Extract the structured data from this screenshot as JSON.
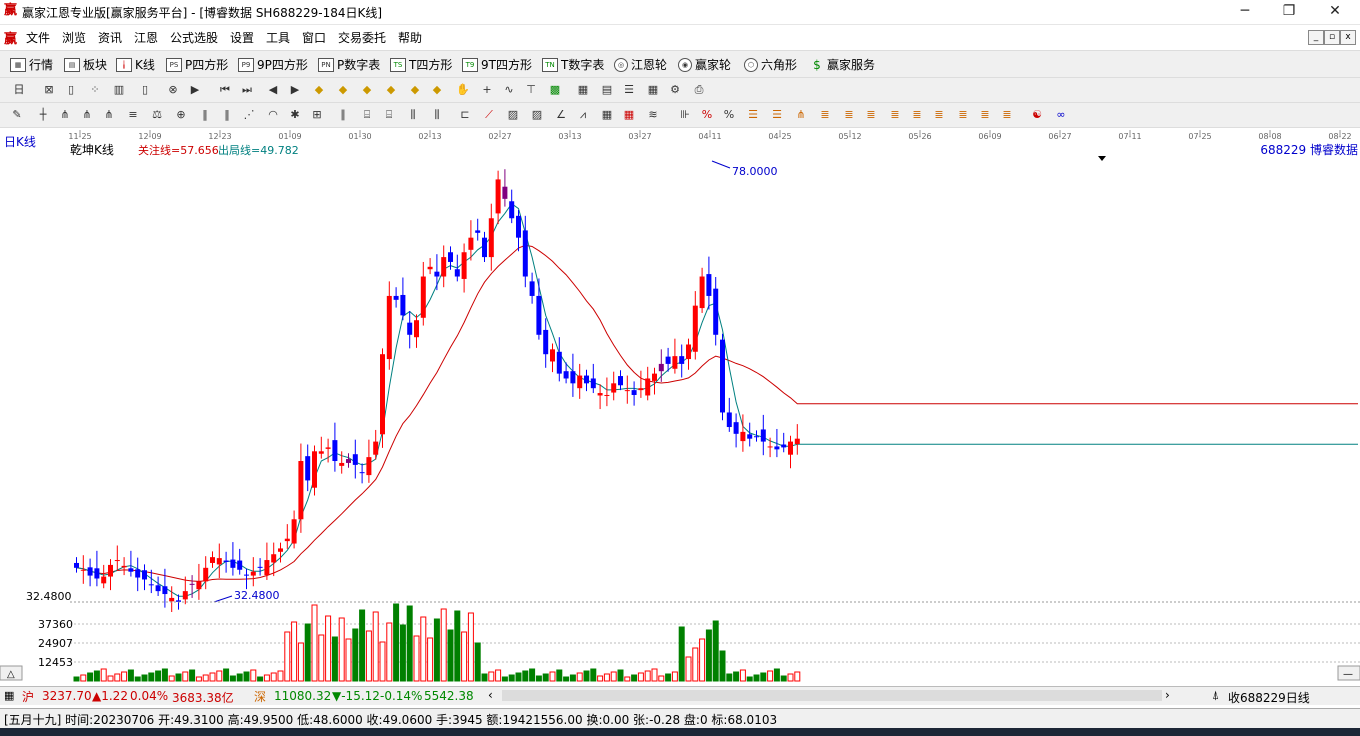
{
  "window": {
    "app_icon": "赢",
    "title": "赢家江恩专业版[赢家服务平台] - [博睿数据   SH688229-184日K线]",
    "minimize": "─",
    "maximize": "❐",
    "close": "✕"
  },
  "menu": [
    "文件",
    "浏览",
    "资讯",
    "江恩",
    "公式选股",
    "设置",
    "工具",
    "窗口",
    "交易委托",
    "帮助"
  ],
  "toolbar1": [
    {
      "icon": "grid-icon",
      "label": "行情"
    },
    {
      "icon": "blocks-icon",
      "label": "板块"
    },
    {
      "icon": "candles-icon",
      "label": "K线"
    },
    {
      "icon": "ps-icon",
      "label": "P四方形"
    },
    {
      "icon": "p9-icon",
      "label": "9P四方形"
    },
    {
      "icon": "pn-icon",
      "label": "P数字表"
    },
    {
      "icon": "ts-icon",
      "label": "T四方形"
    },
    {
      "icon": "t9-icon",
      "label": "9T四方形"
    },
    {
      "icon": "tn-icon",
      "label": "T数字表"
    },
    {
      "icon": "wheel-icon",
      "label": "江恩轮"
    },
    {
      "icon": "wheel2-icon",
      "label": "赢家轮"
    },
    {
      "icon": "hexagon-icon",
      "label": "六角形"
    },
    {
      "icon": "dollar-icon",
      "label": "赢家服务"
    }
  ],
  "chart": {
    "period_label": "日K线",
    "indicator_name": "乾坤K线",
    "focus_line": "关注线=57.656",
    "exit_line": "出局线=49.782",
    "stock_label": "688229  博睿数据",
    "high_marker": "78.0000",
    "low_marker": "32.4800",
    "y_low_label": "32.4800",
    "vol_labels": [
      "37360",
      "24907",
      "12453"
    ],
    "dates": [
      "11-25",
      "12-09",
      "12-23",
      "01-09",
      "01-30",
      "02-13",
      "02-27",
      "03-13",
      "03-27",
      "04-11",
      "04-25",
      "05-12",
      "05-26",
      "06-09",
      "06-27",
      "07-11",
      "07-25",
      "08-08",
      "08-22"
    ],
    "colors": {
      "up": "#ff0000",
      "down": "#0000ff",
      "turn": "#800080",
      "vol_up": "#ff0000",
      "vol_down": "#008000",
      "ma_short": "#008080",
      "ma_long": "#cc0000"
    }
  },
  "chart_data": {
    "type": "candlestick",
    "title": "乾坤K线",
    "candles_close": [
      36.0,
      35.8,
      35.2,
      34.9,
      35.1,
      36.3,
      36.8,
      36.2,
      35.6,
      35.0,
      34.8,
      34.2,
      33.6,
      33.3,
      32.9,
      32.5,
      33.6,
      34.3,
      34.6,
      36.0,
      37.1,
      37.0,
      36.6,
      36.0,
      35.8,
      35.2,
      35.6,
      36.0,
      36.8,
      37.4,
      38.0,
      39.0,
      41.0,
      47.0,
      45.0,
      48.0,
      48.0,
      48.4,
      47.0,
      46.8,
      47.2,
      46.6,
      45.8,
      47.4,
      49.0,
      58.0,
      64.0,
      63.6,
      62.0,
      60.0,
      61.5,
      66.0,
      67.0,
      66.0,
      68.0,
      67.5,
      66.0,
      68.5,
      70.0,
      70.5,
      68.0,
      72.0,
      76.0,
      74.0,
      72.0,
      70.0,
      66.0,
      64.0,
      60.0,
      58.0,
      58.5,
      56.0,
      55.5,
      55.0,
      55.8,
      55.0,
      54.5,
      54.0,
      53.8,
      55.0,
      54.8,
      54.3,
      53.8,
      54.5,
      55.5,
      56.0,
      57.0,
      57.0,
      57.8,
      57.0,
      59.0,
      63.0,
      66.0,
      64.0,
      60.0,
      52.0,
      50.5,
      49.8,
      50.0,
      49.3,
      49.5,
      49.0,
      48.5,
      48.2,
      48.4,
      49.0,
      49.3
    ],
    "focus_line": 57.656,
    "exit_line": 49.782,
    "high": 78.0,
    "low": 32.48,
    "ylim": [
      32.48,
      78.0
    ]
  },
  "index_bar": {
    "sh_value": "3237.70",
    "sh_change": "▲1.22",
    "sh_pct": "0.04%",
    "sh_amount": "3683.38亿",
    "sz_value": "11080.32",
    "sz_change": "▼-15.12",
    "sz_pct": "-0.14%",
    "sz_amount": "5542.38",
    "right_label": "收688229日线"
  },
  "statusbar": {
    "text": "[五月十九] 时间:20230706 开:49.3100 高:49.9500 低:48.6000 收:49.0600 手:3945 额:19421556.00 换:0.00 张:-0.28 盘:0 标:68.0103"
  }
}
